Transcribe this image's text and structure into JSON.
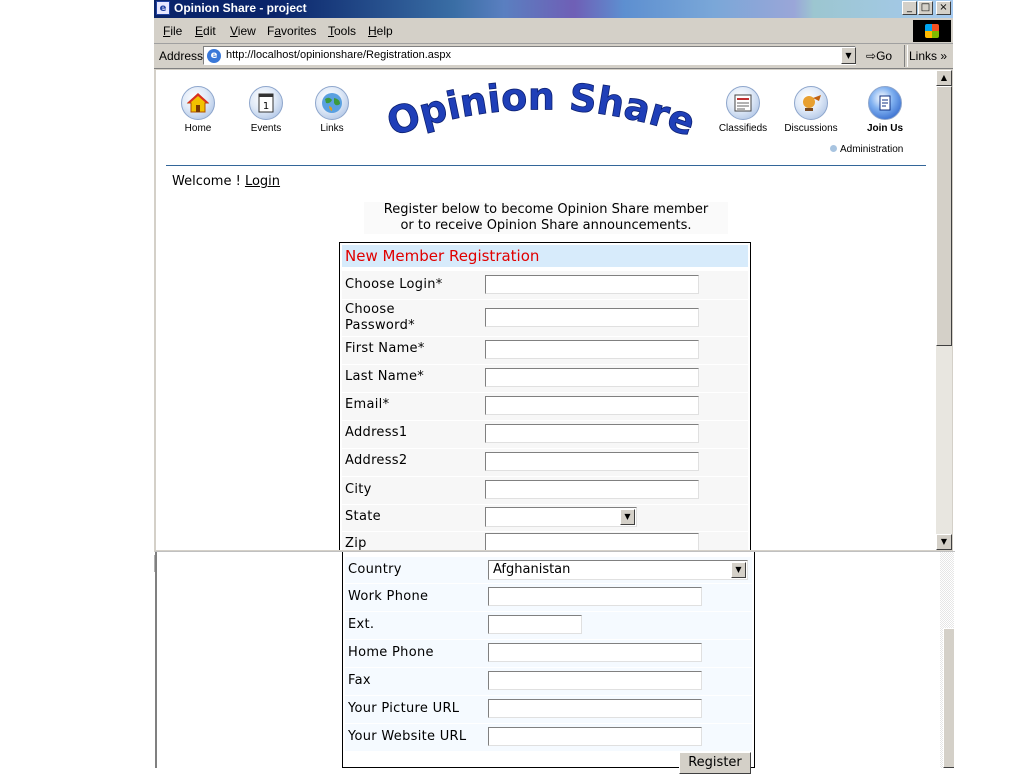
{
  "window": {
    "title": "Opinion Share - project",
    "buttons": {
      "minimize": "_",
      "maximize": "□",
      "close": "×"
    }
  },
  "menubar": {
    "items": [
      {
        "pre": "",
        "u": "F",
        "post": "ile"
      },
      {
        "pre": "",
        "u": "E",
        "post": "dit"
      },
      {
        "pre": "",
        "u": "V",
        "post": "iew"
      },
      {
        "pre": "F",
        "u": "a",
        "post": "vorites"
      },
      {
        "pre": "",
        "u": "T",
        "post": "ools"
      },
      {
        "pre": "",
        "u": "H",
        "post": "elp"
      }
    ]
  },
  "addressbar": {
    "label": "Address",
    "url": "http://localhost/opinionshare/Registration.aspx",
    "go": "Go",
    "links": "Links",
    "links_more": "»"
  },
  "site": {
    "logo_text": "Opinion Share",
    "nav_left": [
      {
        "label": "Home",
        "icon": "home-icon"
      },
      {
        "label": "Events",
        "icon": "calendar-icon"
      },
      {
        "label": "Links",
        "icon": "globe-icon"
      }
    ],
    "nav_right": [
      {
        "label": "Classifieds",
        "icon": "newspaper-icon"
      },
      {
        "label": "Discussions",
        "icon": "chat-icon"
      },
      {
        "label": "Join Us",
        "icon": "join-icon"
      }
    ],
    "admin": "Administration",
    "welcome": "Welcome ! ",
    "login": "Login",
    "intro_line1": "Register below to become Opinion Share member",
    "intro_line2": "or to receive Opinion Share announcements."
  },
  "form": {
    "title": "New Member Registration",
    "fields_top": [
      {
        "label": "Choose Login*",
        "value": ""
      },
      {
        "label": "Choose Password*",
        "value": ""
      },
      {
        "label": "First Name*",
        "value": ""
      },
      {
        "label": "Last Name*",
        "value": ""
      },
      {
        "label": "Email*",
        "value": ""
      },
      {
        "label": "Address1",
        "value": ""
      },
      {
        "label": "Address2",
        "value": ""
      },
      {
        "label": "City",
        "value": ""
      },
      {
        "label": "State",
        "value": ""
      },
      {
        "label": "Zip",
        "value": ""
      }
    ],
    "country_label": "Country",
    "country_value": "Afghanistan",
    "fields_bottom": [
      {
        "label": "Work Phone",
        "value": ""
      },
      {
        "label": "Ext.",
        "value": ""
      },
      {
        "label": "Home Phone",
        "value": ""
      },
      {
        "label": "Fax",
        "value": ""
      },
      {
        "label": "Your Picture URL",
        "value": ""
      },
      {
        "label": "Your Website URL",
        "value": ""
      }
    ],
    "submit": "Register"
  },
  "colors": {
    "logo": "#1f3fb8",
    "form_title": "#e00000",
    "form_header_bg": "#d7ebfb",
    "divider": "#336699"
  }
}
